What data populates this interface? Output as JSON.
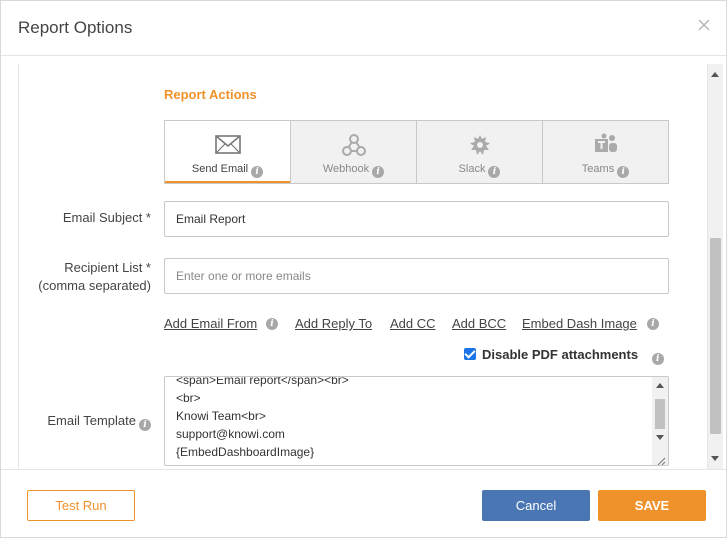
{
  "dialog": {
    "title": "Report Options",
    "close_icon": "close-icon"
  },
  "report_actions": {
    "title": "Report Actions",
    "tabs": [
      {
        "label": "Send Email",
        "icon": "envelope-icon",
        "selected": true
      },
      {
        "label": "Webhook",
        "icon": "webhook-icon",
        "selected": false
      },
      {
        "label": "Slack",
        "icon": "slack-icon",
        "selected": false
      },
      {
        "label": "Teams",
        "icon": "teams-icon",
        "selected": false
      }
    ]
  },
  "form": {
    "email_subject_label": "Email Subject *",
    "email_subject_value": "Email Report",
    "recipient_label_line1": "Recipient List *",
    "recipient_label_line2": "(comma separated)",
    "recipient_placeholder": "Enter one or more emails",
    "links": {
      "add_email_from": "Add Email From",
      "add_reply_to": "Add Reply To",
      "add_cc": "Add CC",
      "add_bcc": "Add BCC",
      "embed_dash_image": "Embed Dash Image"
    },
    "disable_pdf_label": "Disable PDF attachments",
    "disable_pdf_checked": true,
    "email_template_label": "Email Template",
    "email_template_lines": [
      "<span>Email report</span><br>",
      "<br>",
      "Knowi Team<br>",
      "support@knowi.com",
      "{EmbedDashboardImage}"
    ]
  },
  "footer": {
    "test_run": "Test Run",
    "cancel": "Cancel",
    "save": "SAVE"
  },
  "colors": {
    "accent": "#f0922b",
    "primary": "#4a77b4",
    "checkbox": "#1a73e8"
  }
}
